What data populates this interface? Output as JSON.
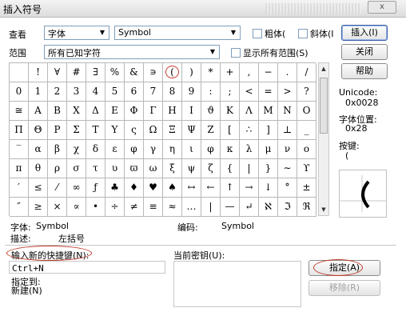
{
  "window": {
    "title": "插入符号",
    "close_label": "x"
  },
  "font_row": {
    "label": "查看",
    "view_value": "字体",
    "font_value": "Symbol",
    "bold_label": "粗体(",
    "italic_label": "斜体(I",
    "insert_button": "插入(I)"
  },
  "range_row": {
    "label": "范围",
    "value": "所有已知字符",
    "show_all_label": "显示所有范围(S)",
    "close_button": "关闭"
  },
  "help_button": "帮助",
  "symbols": [
    [
      "",
      "!",
      "∀",
      "#",
      "∃",
      "%",
      "&",
      "∍",
      "(",
      ")",
      "*",
      "+",
      ",",
      "−",
      ".",
      "/"
    ],
    [
      "0",
      "1",
      "2",
      "3",
      "4",
      "5",
      "6",
      "7",
      "8",
      "9",
      ":",
      ";",
      "<",
      "=",
      ">",
      "?"
    ],
    [
      "≅",
      "Α",
      "Β",
      "Χ",
      "Δ",
      "Ε",
      "Φ",
      "Γ",
      "Η",
      "Ι",
      "ϑ",
      "Κ",
      "Λ",
      "Μ",
      "Ν",
      "Ο"
    ],
    [
      "Π",
      "Θ",
      "Ρ",
      "Σ",
      "Τ",
      "Υ",
      "ς",
      "Ω",
      "Ξ",
      "Ψ",
      "Ζ",
      "[",
      "∴",
      "]",
      "⊥",
      "_"
    ],
    [
      "‾",
      "α",
      "β",
      "χ",
      "δ",
      "ε",
      "φ",
      "γ",
      "η",
      "ι",
      "φ",
      "κ",
      "λ",
      "μ",
      "ν",
      "ο"
    ],
    [
      "π",
      "θ",
      "ρ",
      "σ",
      "τ",
      "υ",
      "ϖ",
      "ω",
      "ξ",
      "ψ",
      "ζ",
      "{",
      "|",
      "}",
      "∼",
      "ϒ"
    ],
    [
      "′",
      "≤",
      "⁄",
      "∞",
      "ƒ",
      "♣",
      "♦",
      "♥",
      "♠",
      "↔",
      "←",
      "↑",
      "→",
      "↓",
      "°",
      "±"
    ],
    [
      "″",
      "≥",
      "×",
      "∝",
      "•",
      "÷",
      "≠",
      "≡",
      "≈",
      "…",
      "|",
      "—",
      "↵",
      "ℵ",
      "ℑ",
      "ℜ"
    ]
  ],
  "selected_symbol": {
    "row": 0,
    "col": 8
  },
  "info": {
    "unicode_label": "Unicode:",
    "unicode_value": "0x0028",
    "position_label": "字体位置:",
    "position_value": "0x28",
    "key_label": "按键:",
    "key_value": "("
  },
  "details": {
    "font_label": "字体:",
    "font_value": "Symbol",
    "desc_label": "描述:",
    "desc_value": "左括号",
    "code_label": "编码:",
    "code_value": "Symbol"
  },
  "shortcut": {
    "new_label": "输入新的快捷键(N):",
    "new_value": "Ctrl+N",
    "current_label": "当前密钥(U):",
    "assign_label": "指定到:",
    "assign_value": "新建(N)",
    "assign_button": "指定(A)",
    "remove_button": "移除(R)"
  }
}
